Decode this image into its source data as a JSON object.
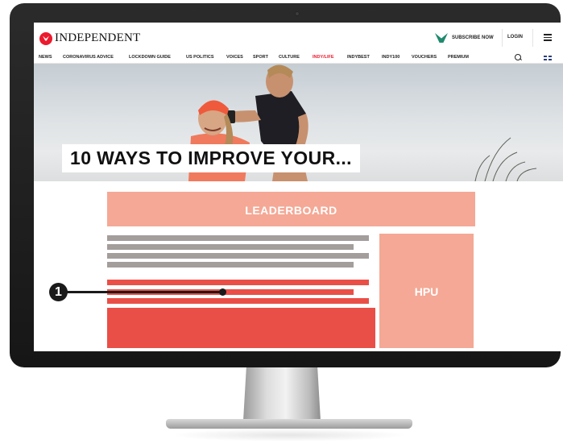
{
  "brand": {
    "name": "INDEPENDENT",
    "accent": "#ec1a2e"
  },
  "header": {
    "subscribe_label": "SUBSCRIBE NOW",
    "login_label": "LOGIN"
  },
  "nav": {
    "items": [
      "NEWS",
      "CORONAVIRUS ADVICE",
      "LOCKDOWN GUIDE",
      "US POLITICS",
      "VOICES",
      "SPORT",
      "CULTURE",
      "INDY/LIFE",
      "INDYBEST",
      "INDY100",
      "VOUCHERS",
      "PREMIUM"
    ]
  },
  "hero": {
    "headline": "10 WAYS TO IMPROVE YOUR..."
  },
  "ads": {
    "leaderboard_label": "LEADERBOARD",
    "hpu_label": "HPU",
    "colors": {
      "light": "#f4a895",
      "strong": "#ea4f47",
      "text_placeholder": "#a39d9c"
    }
  },
  "callout": {
    "number": "1"
  }
}
